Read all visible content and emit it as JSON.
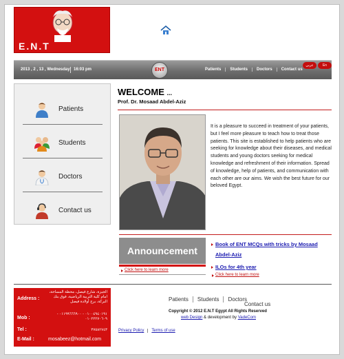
{
  "header": {
    "logo_text": "E.N.T"
  },
  "navbar": {
    "date": "2013 , 2 , 13 , Wednesday",
    "time": "16:03 pm",
    "logo_text": "ENT",
    "links": [
      "Patients",
      "Students",
      "Doctors",
      "Contact us"
    ],
    "lang_ar": "عربي",
    "lang_en": "En"
  },
  "sidebar": {
    "items": [
      {
        "label": "Patients",
        "icon": "patient-icon"
      },
      {
        "label": "Students",
        "icon": "students-icon"
      },
      {
        "label": "Doctors",
        "icon": "doctor-icon"
      },
      {
        "label": "Contact us",
        "icon": "contact-icon"
      }
    ]
  },
  "welcome": {
    "title": "WELCOME",
    "title_suffix": "...",
    "subtitle": "Prof. Dr. Mosaad Abdel-Aziz",
    "text": "It is a pleasure to succeed in treatment of your patients, but I feel more pleasure to teach how to treat those patients. This site is established to help patients who are seeking for knowledge about their diseases, and medical students and young doctors seeking for medical knowledge and refreshment of their information. Spread of knowledge, help of patients, and communication with each other are our aims. We wish the best future for our beloved Egypt."
  },
  "announcement": {
    "title": "Announcement",
    "learn_more_left": "Click here to learn more",
    "items": [
      "Book of ENT MCQs with tricks by Mosaad Abdel-Aziz",
      "ILOs for 4th year"
    ],
    "learn_more_right": "Click here to learn more"
  },
  "footer": {
    "address_label": "Address :",
    "address_value": "الجيزة، شارع فيصل، محطة المساحة، امام كلية التربية الرياضية، فوق بنك البركة، برج أولادة فيصل",
    "mob_label": "Mob :",
    "mob_value": "٠١٠٠٤٩٤٠١٩١ - ٠١١٩٩٦٦٦٩٠٠ - ٠١٠٢٢٢٧٠٦٠٩",
    "tel_label": "Tel :",
    "tel_value": "٣٧٥٨٢٧٤٣",
    "email_label": "E-Mail :",
    "email_value": "mosabeez@hotmail.com",
    "links": [
      "Patients",
      "Students",
      "Doctors"
    ],
    "contact": "Contact us",
    "copyright": "Copyright © 2012 E.N.T Egypt All Rights Reserved",
    "credits_link1": "web Design",
    "credits_mid": " & development by ",
    "credits_link2": "VadeCom",
    "policy_links": [
      "Privacy Policy",
      "Terms of use"
    ]
  },
  "colors": {
    "brand_red": "#d31010",
    "link_blue": "#1a1ab0",
    "nav_gray": "#6e6e6e"
  }
}
